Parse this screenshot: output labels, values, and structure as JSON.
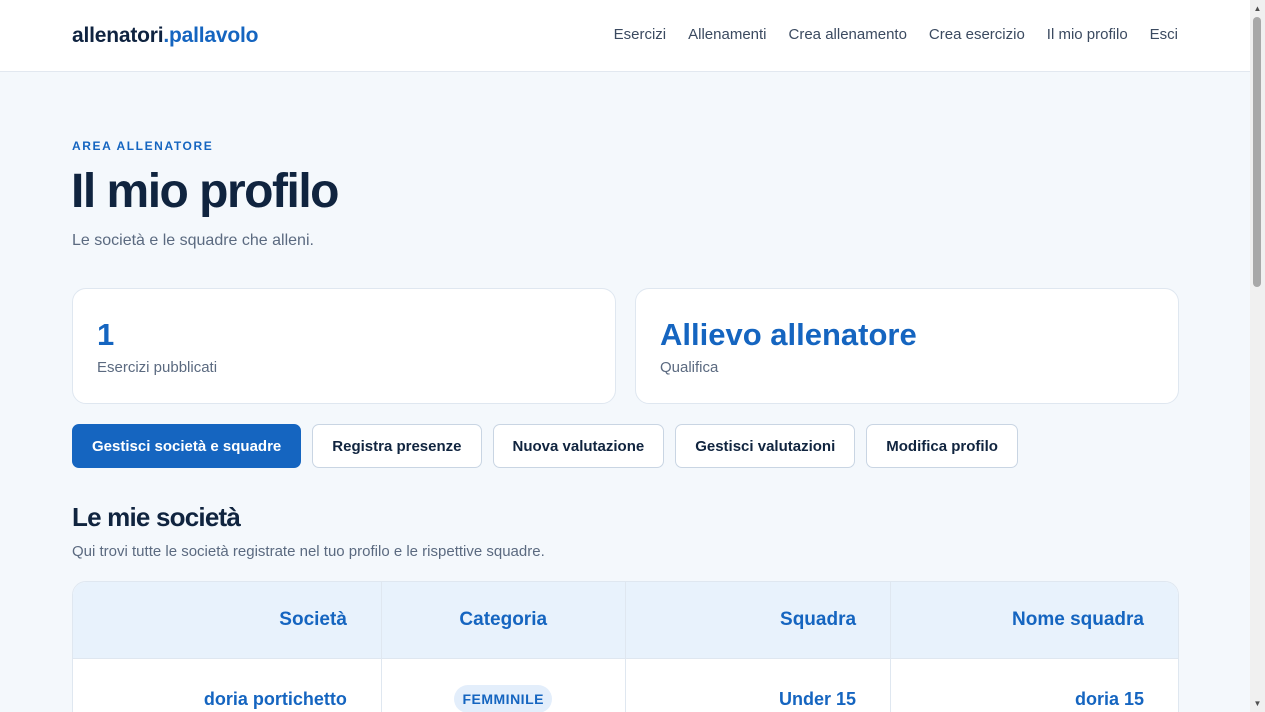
{
  "header": {
    "brand_main": "allenatori",
    "brand_accent": ".pallavolo",
    "nav": [
      "Esercizi",
      "Allenamenti",
      "Crea allenamento",
      "Crea esercizio",
      "Il mio profilo",
      "Esci"
    ]
  },
  "hero": {
    "eyebrow": "AREA ALLENATORE",
    "title": "Il mio profilo",
    "subtitle": "Le società e le squadre che alleni."
  },
  "stats": [
    {
      "value": "1",
      "label": "Esercizi pubblicati"
    },
    {
      "value": "Allievo allenatore",
      "label": "Qualifica"
    }
  ],
  "actions": [
    "Gestisci società e squadre",
    "Registra presenze",
    "Nuova valutazione",
    "Gestisci valutazioni",
    "Modifica profilo"
  ],
  "section": {
    "title": "Le mie società",
    "subtitle": "Qui trovi tutte le società registrate nel tuo profilo e le rispettive squadre."
  },
  "table": {
    "headers": [
      "Società",
      "Categoria",
      "Squadra",
      "Nome squadra"
    ],
    "rows": [
      {
        "societa": "doria portichetto",
        "categoria": "FEMMINILE",
        "squadra": "Under 15",
        "nome_squadra": "doria 15"
      }
    ]
  },
  "colors": {
    "accent": "#1565c0",
    "text": "#10243f",
    "background": "#f4f8fc"
  }
}
